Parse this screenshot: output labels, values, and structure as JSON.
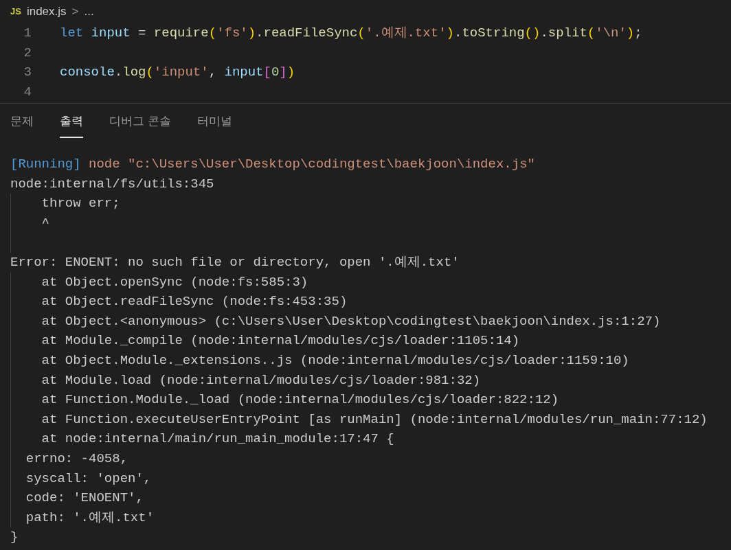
{
  "breadcrumb": {
    "icon": "JS",
    "file": "index.js",
    "separator": ">",
    "rest": "..."
  },
  "editor": {
    "lines": [
      {
        "number": "1",
        "tokens": [
          {
            "text": "let",
            "kind": "keyword"
          },
          {
            "text": " input",
            "kind": "variable"
          },
          {
            "text": " = ",
            "kind": "plain"
          },
          {
            "text": "require",
            "kind": "function"
          },
          {
            "text": "(",
            "kind": "bracket"
          },
          {
            "text": "'fs'",
            "kind": "string"
          },
          {
            "text": ")",
            "kind": "bracket"
          },
          {
            "text": ".",
            "kind": "plain"
          },
          {
            "text": "readFileSync",
            "kind": "function"
          },
          {
            "text": "(",
            "kind": "bracket"
          },
          {
            "text": "'.예제.txt'",
            "kind": "string"
          },
          {
            "text": ")",
            "kind": "bracket"
          },
          {
            "text": ".",
            "kind": "plain"
          },
          {
            "text": "toString",
            "kind": "function"
          },
          {
            "text": "()",
            "kind": "bracket"
          },
          {
            "text": ".",
            "kind": "plain"
          },
          {
            "text": "split",
            "kind": "function"
          },
          {
            "text": "(",
            "kind": "bracket"
          },
          {
            "text": "'\\n'",
            "kind": "string"
          },
          {
            "text": ")",
            "kind": "bracket"
          },
          {
            "text": ";",
            "kind": "plain"
          }
        ]
      },
      {
        "number": "2"
      },
      {
        "number": "3",
        "tokens": [
          {
            "text": "console",
            "kind": "variable"
          },
          {
            "text": ".",
            "kind": "plain"
          },
          {
            "text": "log",
            "kind": "function"
          },
          {
            "text": "(",
            "kind": "bracket"
          },
          {
            "text": "'input'",
            "kind": "string"
          },
          {
            "text": ", ",
            "kind": "plain"
          },
          {
            "text": "input",
            "kind": "variable"
          },
          {
            "text": "[",
            "kind": "bracket2"
          },
          {
            "text": "0",
            "kind": "number"
          },
          {
            "text": "]",
            "kind": "bracket2"
          },
          {
            "text": ")",
            "kind": "bracket"
          }
        ]
      },
      {
        "number": "4"
      }
    ]
  },
  "panel": {
    "tabs": [
      {
        "label": "문제",
        "selected": false
      },
      {
        "label": "출력",
        "selected": true
      },
      {
        "label": "디버그 콘솔",
        "selected": false
      },
      {
        "label": "터미널",
        "selected": false
      }
    ],
    "output": [
      {
        "guide": false,
        "segments": [
          {
            "text": "[Running]",
            "kind": "info"
          },
          {
            "text": " node \"c:\\Users\\User\\Desktop\\codingtest\\baekjoon\\index.js\"",
            "kind": "command"
          }
        ]
      },
      {
        "guide": false,
        "segments": [
          {
            "text": "node:internal/fs/utils:345",
            "kind": "plain"
          }
        ]
      },
      {
        "guide": true,
        "segments": [
          {
            "text": "    throw err;",
            "kind": "plain"
          }
        ]
      },
      {
        "guide": true,
        "segments": [
          {
            "text": "    ^",
            "kind": "plain"
          }
        ]
      },
      {
        "guide": true
      },
      {
        "guide": false,
        "segments": [
          {
            "text": "Error: ENOENT: no such file or directory, open '.예제.txt'",
            "kind": "plain"
          }
        ]
      },
      {
        "guide": true,
        "segments": [
          {
            "text": "    at Object.openSync (node:fs:585:3)",
            "kind": "plain"
          }
        ]
      },
      {
        "guide": true,
        "segments": [
          {
            "text": "    at Object.readFileSync (node:fs:453:35)",
            "kind": "plain"
          }
        ]
      },
      {
        "guide": true,
        "segments": [
          {
            "text": "    at Object.<anonymous> (c:\\Users\\User\\Desktop\\codingtest\\baekjoon\\index.js:1:27)",
            "kind": "plain"
          }
        ]
      },
      {
        "guide": true,
        "segments": [
          {
            "text": "    at Module._compile (node:internal/modules/cjs/loader:1105:14)",
            "kind": "plain"
          }
        ]
      },
      {
        "guide": true,
        "segments": [
          {
            "text": "    at Object.Module._extensions..js (node:internal/modules/cjs/loader:1159:10)",
            "kind": "plain"
          }
        ]
      },
      {
        "guide": true,
        "segments": [
          {
            "text": "    at Module.load (node:internal/modules/cjs/loader:981:32)",
            "kind": "plain"
          }
        ]
      },
      {
        "guide": true,
        "segments": [
          {
            "text": "    at Function.Module._load (node:internal/modules/cjs/loader:822:12)",
            "kind": "plain"
          }
        ]
      },
      {
        "guide": true,
        "segments": [
          {
            "text": "    at Function.executeUserEntryPoint [as runMain] (node:internal/modules/run_main:77:12)",
            "kind": "plain"
          }
        ]
      },
      {
        "guide": true,
        "segments": [
          {
            "text": "    at node:internal/main/run_main_module:17:47 {",
            "kind": "plain"
          }
        ]
      },
      {
        "guide": true,
        "segments": [
          {
            "text": "  errno: -4058,",
            "kind": "plain"
          }
        ]
      },
      {
        "guide": true,
        "segments": [
          {
            "text": "  syscall: 'open',",
            "kind": "plain"
          }
        ]
      },
      {
        "guide": true,
        "segments": [
          {
            "text": "  code: 'ENOENT',",
            "kind": "plain"
          }
        ]
      },
      {
        "guide": true,
        "segments": [
          {
            "text": "  path: '.예제.txt'",
            "kind": "plain"
          }
        ]
      },
      {
        "guide": false,
        "segments": [
          {
            "text": "}",
            "kind": "plain"
          }
        ]
      }
    ]
  }
}
